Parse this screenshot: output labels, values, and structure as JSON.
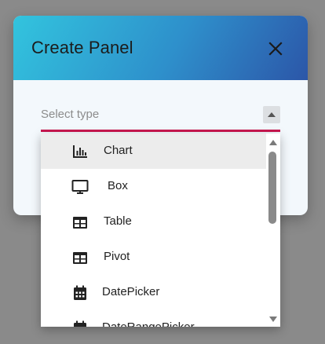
{
  "dialog": {
    "title": "Create Panel",
    "close_icon": "close-icon"
  },
  "select": {
    "placeholder": "Select type",
    "arrow_icon": "triangle-up-icon",
    "underline_color": "#c8174f"
  },
  "dropdown": {
    "options": [
      {
        "label": "Chart",
        "icon": "bar-chart-icon",
        "selected": true
      },
      {
        "label": "Box",
        "icon": "monitor-icon",
        "selected": false
      },
      {
        "label": "Table",
        "icon": "table-icon",
        "selected": false
      },
      {
        "label": "Pivot",
        "icon": "table-icon",
        "selected": false
      },
      {
        "label": "DatePicker",
        "icon": "calendar-icon",
        "selected": false
      },
      {
        "label": "DateRangePicker",
        "icon": "calendar-icon",
        "selected": false
      }
    ]
  },
  "colors": {
    "header_gradient_start": "#32c4de",
    "header_gradient_end": "#2c56a8",
    "accent": "#c8174f",
    "dialog_body": "#f3f8fc"
  }
}
